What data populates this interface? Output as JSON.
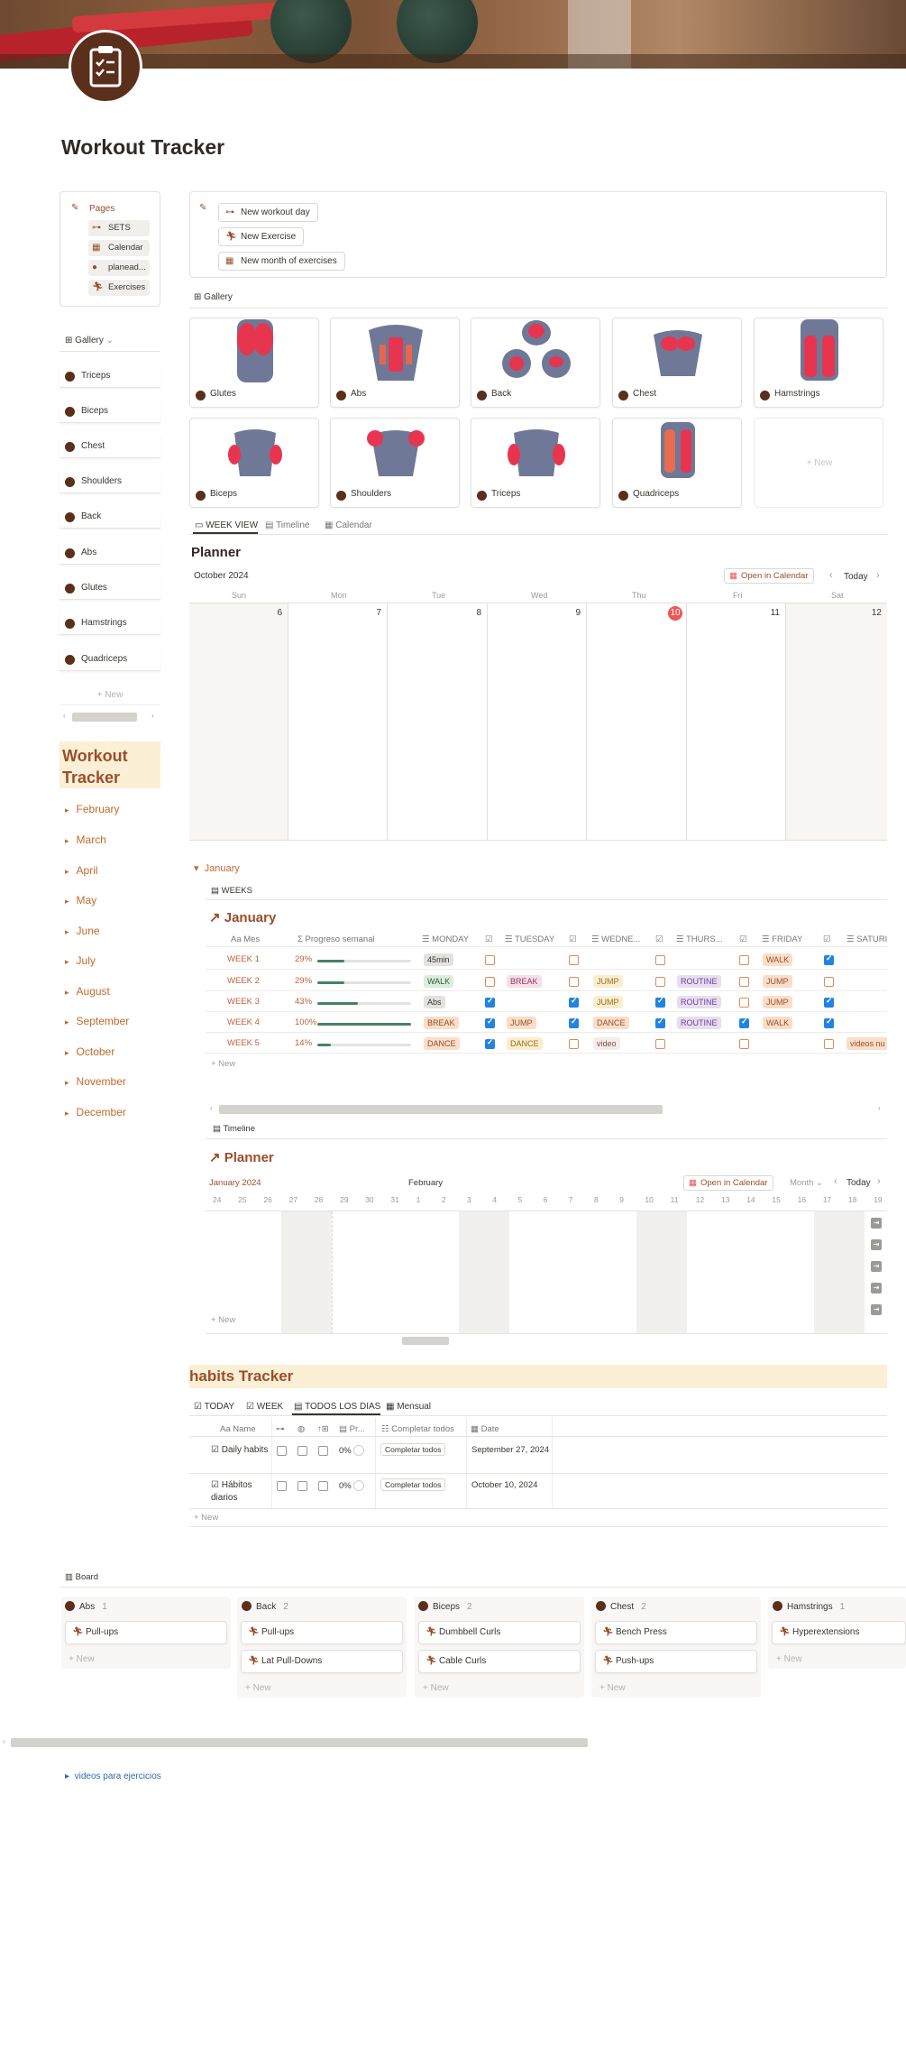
{
  "page_title": "Workout Tracker",
  "pages_box": {
    "header": "Pages",
    "items": [
      {
        "label": "SETS",
        "icon": "dumbbell-icon"
      },
      {
        "label": "Calendar",
        "icon": "calendar-icon"
      },
      {
        "label": "planead...",
        "icon": "apple-icon"
      },
      {
        "label": "Exercises",
        "icon": "runner-icon"
      }
    ]
  },
  "left_gallery": {
    "label": "Gallery",
    "items": [
      "Triceps",
      "Biceps",
      "Chest",
      "Shoulders",
      "Back",
      "Abs",
      "Glutes",
      "Hamstrings",
      "Quadriceps"
    ],
    "new_label": "+ New"
  },
  "left_title": "Workout Tracker",
  "months": [
    "February",
    "March",
    "April",
    "May",
    "June",
    "July",
    "August",
    "September",
    "October",
    "November",
    "December"
  ],
  "buttons": {
    "new_workout_day": "New workout day",
    "new_exercise": "New Exercise",
    "new_month": "New month of exercises"
  },
  "gallery": {
    "label": "Gallery",
    "cards": [
      "Glutes",
      "Abs",
      "Back",
      "Chest",
      "Hamstrings",
      "Biceps",
      "Shoulders",
      "Triceps",
      "Quadriceps"
    ],
    "new_label": "+ New"
  },
  "planner_tabs": [
    "WEEK VIEW",
    "Timeline",
    "Calendar"
  ],
  "planner": {
    "title": "Planner",
    "month": "October 2024",
    "open_calendar": "Open in Calendar",
    "today": "Today",
    "days": [
      "Sun",
      "Mon",
      "Tue",
      "Wed",
      "Thu",
      "Fri",
      "Sat"
    ],
    "dates": [
      "6",
      "7",
      "8",
      "9",
      "10",
      "11",
      "12"
    ],
    "today_date": "10"
  },
  "january": {
    "toggle": "January",
    "view": "WEEKS",
    "title": "January",
    "columns": [
      "Mes",
      "Progreso semanal",
      "MONDAY",
      "TUESDAY",
      "WEDNE...",
      "THURS...",
      "FRIDAY",
      "SATURI"
    ],
    "rows": [
      {
        "week": "WEEK 1",
        "pct": "29%",
        "progress": 0.29,
        "mon": "45min",
        "tue": "",
        "wed": "",
        "thu": "",
        "fri": "WALK",
        "sat": ""
      },
      {
        "week": "WEEK 2",
        "pct": "29%",
        "progress": 0.29,
        "mon": "WALK",
        "tue": "BREAK",
        "wed": "JUMP",
        "thu": "ROUTINE",
        "fri": "JUMP",
        "sat": ""
      },
      {
        "week": "WEEK 3",
        "pct": "43%",
        "progress": 0.43,
        "mon": "Abs",
        "tue": "",
        "wed": "JUMP",
        "thu": "ROUTINE",
        "fri": "JUMP",
        "sat": ""
      },
      {
        "week": "WEEK 4",
        "pct": "100%",
        "progress": 1.0,
        "mon": "BREAK",
        "tue": "JUMP",
        "wed": "DANCE",
        "thu": "ROUTINE",
        "fri": "WALK",
        "sat": ""
      },
      {
        "week": "WEEK 5",
        "pct": "14%",
        "progress": 0.14,
        "mon": "DANCE",
        "tue": "DANCE",
        "wed": "video",
        "thu": "",
        "fri": "",
        "sat": "videos nu"
      }
    ],
    "new_label": "+ New"
  },
  "timeline": {
    "view": "Timeline",
    "title": "Planner",
    "month_left": "January 2024",
    "month_center": "February",
    "open_calendar": "Open in Calendar",
    "scale": "Month",
    "today": "Today",
    "days": [
      "24",
      "25",
      "26",
      "27",
      "28",
      "29",
      "30",
      "31",
      "1",
      "2",
      "3",
      "4",
      "5",
      "6",
      "7",
      "8",
      "9",
      "10",
      "11",
      "12",
      "13",
      "14",
      "15",
      "16",
      "17",
      "18",
      "19"
    ],
    "new_label": "+ New"
  },
  "habits": {
    "title": "habits Tracker",
    "tabs": [
      "TODAY",
      "WEEK",
      "TODOS LOS DIAS",
      "Mensual"
    ],
    "columns": [
      "Name",
      "Pr...",
      "Completar todos",
      "Date"
    ],
    "rows": [
      {
        "name": "Daily habits",
        "pct": "0%",
        "button": "Completar todos",
        "date": "September 27, 2024"
      },
      {
        "name": "Hábitos diarios",
        "pct": "0%",
        "button": "Completar todos",
        "date": "October 10, 2024"
      }
    ],
    "new_label": "+ New"
  },
  "board": {
    "label": "Board",
    "columns": [
      {
        "name": "Abs",
        "count": "1",
        "cards": [
          "Pull-ups"
        ]
      },
      {
        "name": "Back",
        "count": "2",
        "cards": [
          "Pull-ups",
          "Lat Pull-Downs"
        ]
      },
      {
        "name": "Biceps",
        "count": "2",
        "cards": [
          "Dumbbell Curls",
          "Cable Curls"
        ]
      },
      {
        "name": "Chest",
        "count": "2",
        "cards": [
          "Bench Press",
          "Push-ups"
        ]
      },
      {
        "name": "Hamstrings",
        "count": "1",
        "cards": [
          "Hyperextensions"
        ]
      }
    ],
    "new_label": "+ New"
  },
  "footer_toggle": "videos para ejercicios",
  "colors": {
    "accent": "#9b4d2a",
    "orange": "#c26a2c",
    "highlight": "#fbf0d6",
    "today": "#eb5757",
    "check": "#2383e2"
  }
}
